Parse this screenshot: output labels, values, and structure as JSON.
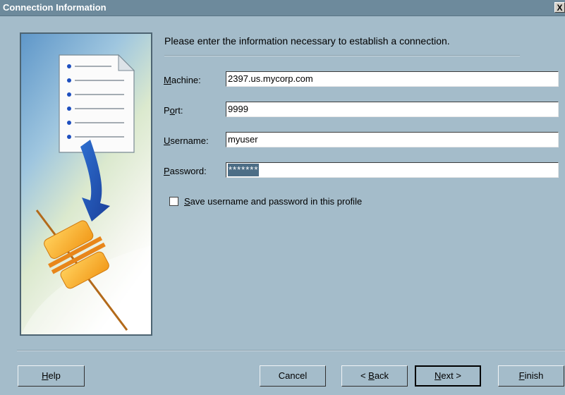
{
  "window": {
    "title": "Connection Information",
    "close_glyph": "X"
  },
  "intro_text": "Please enter the information necessary to establish a connection.",
  "fields": {
    "machine": {
      "label_prefix": "",
      "label_mnemonic": "M",
      "label_rest": "achine:",
      "value": "2397.us.mycorp.com"
    },
    "port": {
      "label_prefix": "P",
      "label_mnemonic": "o",
      "label_rest": "rt:",
      "value": "9999"
    },
    "username": {
      "label_prefix": "",
      "label_mnemonic": "U",
      "label_rest": "sername:",
      "value": "myuser"
    },
    "password": {
      "label_prefix": "",
      "label_mnemonic": "P",
      "label_rest": "assword:",
      "value": "*******"
    }
  },
  "save_checkbox": {
    "checked": false,
    "label_mnemonic": "S",
    "label_rest": "ave username and password in this profile"
  },
  "buttons": {
    "help": {
      "mnemonic": "H",
      "rest": "elp"
    },
    "cancel": {
      "label": "Cancel"
    },
    "back": {
      "prefix": "< ",
      "mnemonic": "B",
      "rest": "ack"
    },
    "next": {
      "prefix": "",
      "mnemonic": "N",
      "rest": "ext >"
    },
    "finish": {
      "mnemonic": "F",
      "rest": "inish"
    }
  },
  "illustration": {
    "icons": [
      "document-icon",
      "arrow-icon",
      "connector-plug-icon"
    ]
  },
  "colors": {
    "background": "#a4bcca",
    "titlebar": "#6d8a9c",
    "selection": "#4d6e86"
  }
}
